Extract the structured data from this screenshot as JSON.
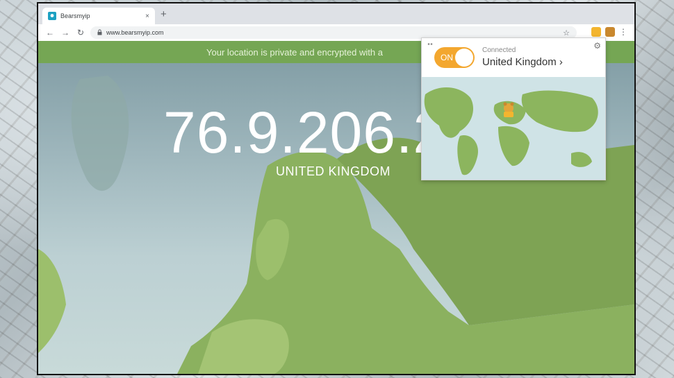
{
  "browser": {
    "tab_title": "Bearsmyip",
    "tab_close": "×",
    "new_tab": "+",
    "nav": {
      "back": "←",
      "forward": "→",
      "reload": "↻"
    },
    "url": "www.bearsmyip.com",
    "star": "☆",
    "menu": "⋮"
  },
  "page": {
    "banner_text": "Your location is private and encrypted with a",
    "ip_address": "76.9.206.2",
    "country": "UNITED KINGDOM"
  },
  "extension_popup": {
    "toggle_label": "ON",
    "status": "Connected",
    "location": "United Kingdom",
    "location_chevron": "›",
    "settings_icon": "⚙"
  },
  "colors": {
    "banner": "#75a654",
    "toggle_on": "#f3a72f",
    "land": "#8bb15f"
  },
  "icons": [
    "lock-icon",
    "star-icon",
    "gear-icon",
    "bear-extension-icon"
  ]
}
